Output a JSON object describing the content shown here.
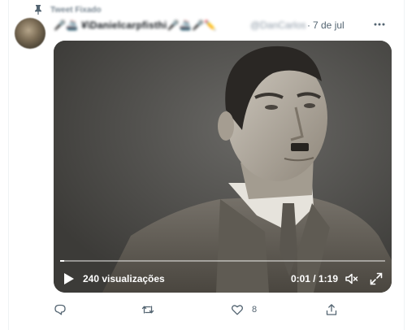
{
  "tweet": {
    "pinned_label": "Tweet Fixado",
    "author_name": "🎤🚢 ¥\\Danielcarpfisthi🎤🚢🎤✏️",
    "author_handle": "@DanCarlos",
    "separator": "·",
    "date": "7 de jul",
    "more_icon": "more-horizontal-icon"
  },
  "video": {
    "views": "240 visualizações",
    "time": "0:01 / 1:19",
    "progress": 0.013,
    "play_icon": "play-icon",
    "volume_icon": "volume-icon",
    "fullscreen_icon": "fullscreen-icon"
  },
  "actions": {
    "reply_icon": "reply-icon",
    "retweet_icon": "retweet-icon",
    "like_icon": "heart-icon",
    "like_count": "8",
    "share_icon": "share-icon"
  },
  "colors": {
    "text_secondary": "#536471",
    "border": "#eff3f4"
  }
}
